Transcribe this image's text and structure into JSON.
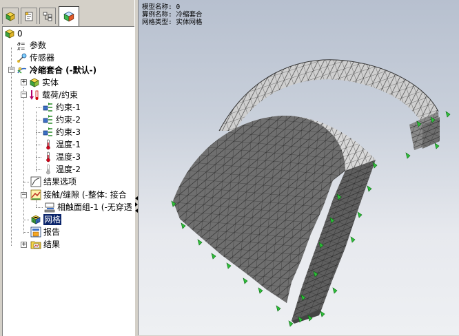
{
  "tabs": [
    {
      "name": "feature-manager",
      "active": false
    },
    {
      "name": "property-manager",
      "active": false
    },
    {
      "name": "configuration-manager",
      "active": false
    },
    {
      "name": "simulation-manager",
      "active": true
    }
  ],
  "tree": {
    "root": "0",
    "items": [
      {
        "label": "参数"
      },
      {
        "label": "传感器"
      },
      {
        "label": "冷缩套合 (-默认-)"
      },
      {
        "label": "实体"
      },
      {
        "label": "载荷/约束"
      },
      {
        "label": "约束-1"
      },
      {
        "label": "约束-2"
      },
      {
        "label": "约束-3"
      },
      {
        "label": "温度-1"
      },
      {
        "label": "温度-3"
      },
      {
        "label": "温度-2"
      },
      {
        "label": "结果选项"
      },
      {
        "label": "接触/缝隙 (-整体: 接合"
      },
      {
        "label": "相触面组-1 (-无穿透"
      },
      {
        "label": "网格"
      },
      {
        "label": "报告"
      },
      {
        "label": "结果"
      }
    ]
  },
  "viewport": {
    "info": [
      "模型名称: 0",
      "算例名称: 冷缩套合",
      "网格类型: 实体网格"
    ]
  }
}
